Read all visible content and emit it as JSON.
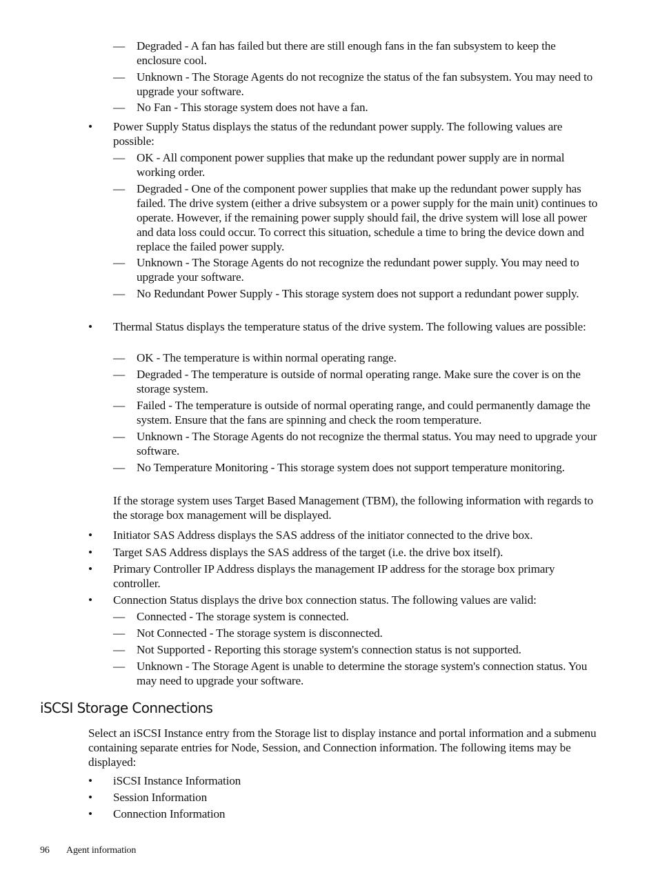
{
  "fan_status_values": [
    "Degraded - A fan has failed but there are still enough fans in the fan subsystem to keep the enclosure cool.",
    "Unknown - The Storage Agents do not recognize the status of the fan subsystem. You may need to upgrade your software.",
    "No Fan - This storage system does not have a fan."
  ],
  "power_supply": {
    "intro": "Power Supply Status displays the status of the redundant power supply. The following values are possible:",
    "values": [
      "OK - All component power supplies that make up the redundant power supply are in normal working order.",
      "Degraded - One of the component power supplies that make up the redundant power supply has failed. The drive system (either a drive subsystem or a power supply for the main unit) continues to operate. However, if the remaining power supply should fail, the drive system will lose all power and data loss could occur. To correct this situation, schedule a time to bring the device down and replace the failed power supply.",
      "Unknown - The Storage Agents do not recognize the redundant power supply. You may need to upgrade your software.",
      "No Redundant Power Supply - This storage system does not support a redundant power supply."
    ]
  },
  "thermal": {
    "intro": "Thermal Status displays the temperature status of the drive system. The following values are possible:",
    "values": [
      "OK - The temperature is within normal operating range.",
      "Degraded - The temperature is outside of normal operating range. Make sure the cover is on the storage system.",
      "Failed - The temperature is outside of normal operating range, and could permanently damage the system. Ensure that the fans are spinning and check the room temperature.",
      "Unknown - The Storage Agents do not recognize the thermal status. You may need to upgrade your software.",
      "No Temperature Monitoring - This storage system does not support temperature monitoring."
    ]
  },
  "tbm_paragraph": "If the storage system uses Target Based Management (TBM), the following information with regards to the storage box management will be displayed.",
  "tbm_items": [
    "Initiator SAS Address displays the SAS address of the initiator connected to the drive box.",
    "Target SAS Address displays the SAS address of the target (i.e. the drive box itself).",
    "Primary Controller IP Address displays the management IP address for the storage box primary controller.",
    "Connection Status displays the drive box connection status. The following values are valid:"
  ],
  "connection_status_values": [
    "Connected - The storage system is connected.",
    "Not Connected - The storage system is disconnected.",
    "Not Supported - Reporting this storage system's connection status is not supported.",
    "Unknown - The Storage Agent is unable to determine the storage system's connection status. You may need to upgrade your software."
  ],
  "iscsi": {
    "heading": "iSCSI Storage Connections",
    "paragraph": "Select an iSCSI Instance entry from the Storage list to display instance and portal information and a submenu containing separate entries for Node, Session, and Connection information. The following items may be displayed:",
    "items": [
      "iSCSI Instance Information",
      "Session Information",
      "Connection Information"
    ]
  },
  "marks": {
    "dash": "—",
    "bullet": "•"
  },
  "footer": {
    "page_number": "96",
    "section": "Agent information"
  }
}
